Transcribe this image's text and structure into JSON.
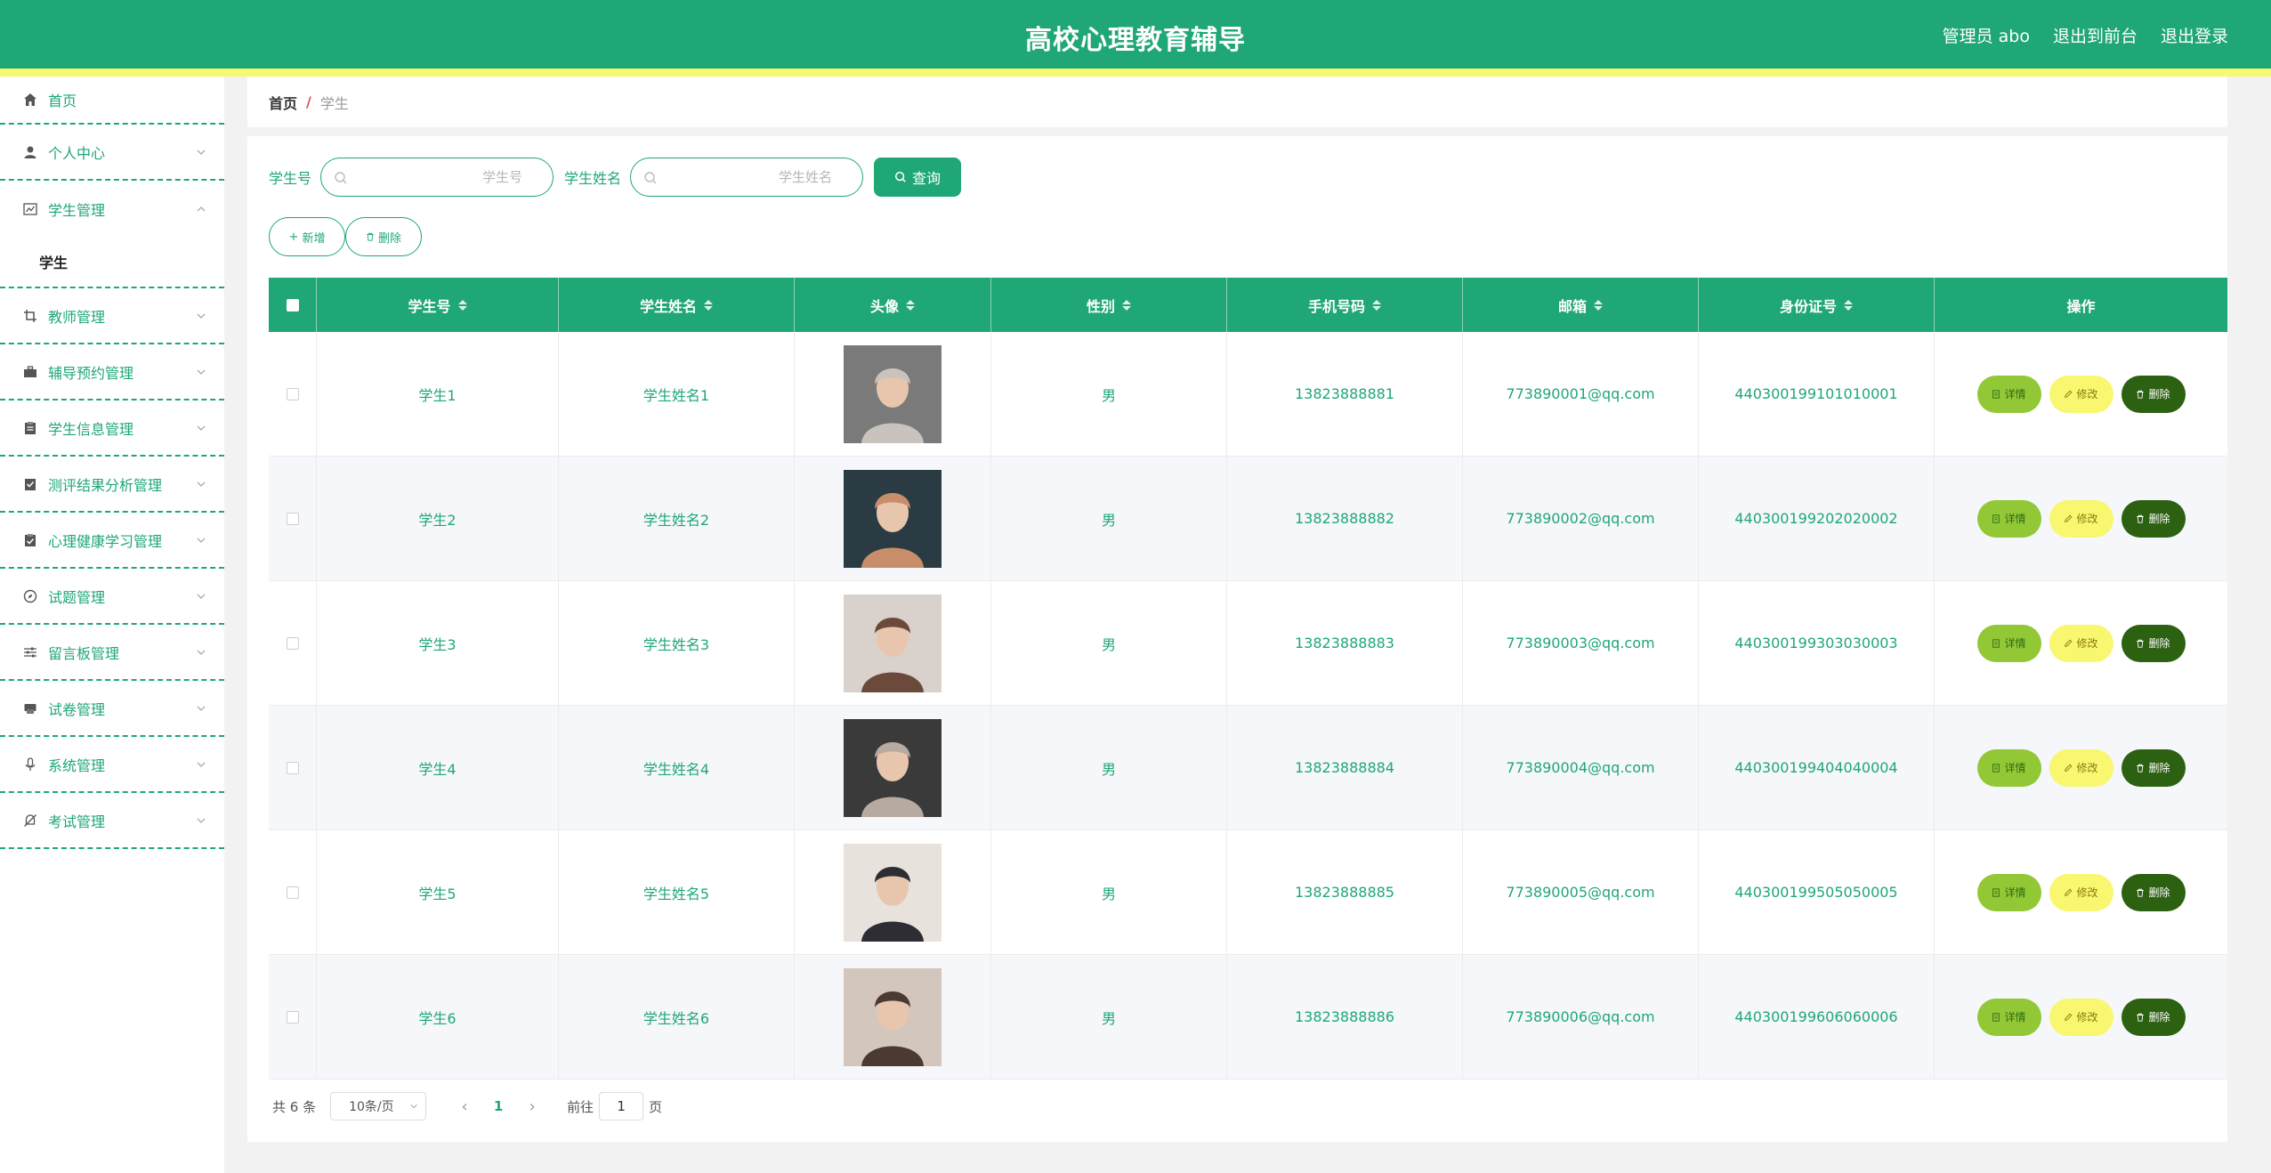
{
  "header": {
    "title": "高校心理教育辅导",
    "admin": "管理员 abo",
    "to_front": "退出到前台",
    "logout": "退出登录"
  },
  "colors": {
    "primary": "#1fa775",
    "strip": "#f7fa70",
    "detail_btn": "#92c736",
    "edit_btn": "#f9f770",
    "delete_btn": "#2c6111"
  },
  "sidebar": {
    "items": [
      {
        "label": "首页",
        "icon": "home-icon"
      },
      {
        "label": "个人中心",
        "icon": "user-icon"
      },
      {
        "label": "学生管理",
        "icon": "chart-icon",
        "expanded": true,
        "children": [
          "学生"
        ]
      },
      {
        "label": "教师管理",
        "icon": "crop-icon"
      },
      {
        "label": "辅导预约管理",
        "icon": "briefcase-icon"
      },
      {
        "label": "学生信息管理",
        "icon": "clipboard-icon"
      },
      {
        "label": "测评结果分析管理",
        "icon": "checklist-icon"
      },
      {
        "label": "心理健康学习管理",
        "icon": "clipboard-check-icon"
      },
      {
        "label": "试题管理",
        "icon": "compass-icon"
      },
      {
        "label": "留言板管理",
        "icon": "sliders-icon"
      },
      {
        "label": "试卷管理",
        "icon": "printer-icon"
      },
      {
        "label": "系统管理",
        "icon": "microphone-icon"
      },
      {
        "label": "考试管理",
        "icon": "bell-off-icon"
      }
    ]
  },
  "breadcrumb": {
    "home": "首页",
    "sep": "/",
    "current": "学生"
  },
  "search": {
    "label_no": "学生号",
    "placeholder_no": "学生号",
    "label_name": "学生姓名",
    "placeholder_name": "学生姓名",
    "query": "查询"
  },
  "actions": {
    "add": "新增",
    "delete": "删除"
  },
  "table": {
    "columns": [
      "学生号",
      "学生姓名",
      "头像",
      "性别",
      "手机号码",
      "邮箱",
      "身份证号",
      "操作"
    ],
    "rows": [
      {
        "no": "学生1",
        "name": "学生姓名1",
        "sex": "男",
        "phone": "13823888881",
        "email": "773890001@qq.com",
        "id": "440300199101010001"
      },
      {
        "no": "学生2",
        "name": "学生姓名2",
        "sex": "男",
        "phone": "13823888882",
        "email": "773890002@qq.com",
        "id": "440300199202020002"
      },
      {
        "no": "学生3",
        "name": "学生姓名3",
        "sex": "男",
        "phone": "13823888883",
        "email": "773890003@qq.com",
        "id": "440300199303030003"
      },
      {
        "no": "学生4",
        "name": "学生姓名4",
        "sex": "男",
        "phone": "13823888884",
        "email": "773890004@qq.com",
        "id": "440300199404040004"
      },
      {
        "no": "学生5",
        "name": "学生姓名5",
        "sex": "男",
        "phone": "13823888885",
        "email": "773890005@qq.com",
        "id": "440300199505050005"
      },
      {
        "no": "学生6",
        "name": "学生姓名6",
        "sex": "男",
        "phone": "13823888886",
        "email": "773890006@qq.com",
        "id": "440300199606060006"
      }
    ],
    "op_detail": "详情",
    "op_edit": "修改",
    "op_delete": "删除"
  },
  "pager": {
    "total": "共 6 条",
    "page_size": "10条/页",
    "current": "1",
    "goto": "前往",
    "page_input": "1",
    "page_unit": "页"
  }
}
